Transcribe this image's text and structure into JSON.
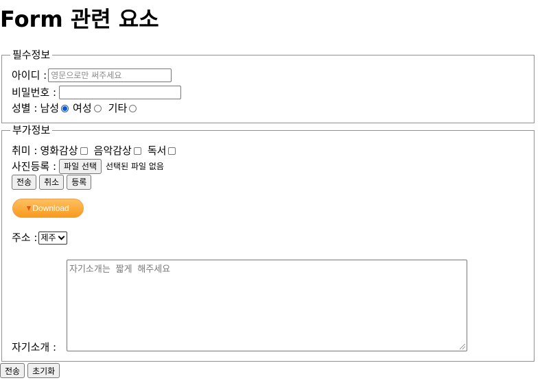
{
  "page": {
    "title": "Form 관련 요소"
  },
  "required": {
    "legend": "필수정보",
    "id_label": "아이디 :",
    "id_placeholder": "영문으로만 써주세요",
    "password_label": "비밀번호 :",
    "password_value": "",
    "gender_label": "성별 :",
    "gender_options": [
      {
        "label": "남성",
        "checked": true
      },
      {
        "label": "여성",
        "checked": false
      },
      {
        "label": "기타",
        "checked": false
      }
    ]
  },
  "additional": {
    "legend": "부가정보",
    "hobby_label": "취미 :",
    "hobby_options": [
      {
        "label": "영화감상",
        "checked": false
      },
      {
        "label": "음악감상",
        "checked": false
      },
      {
        "label": "독서",
        "checked": false
      }
    ],
    "photo_label": "사진등록 :",
    "file_button": "파일 선택",
    "file_status": "선택된 파일 없음",
    "buttons": [
      "전송",
      "취소",
      "등록"
    ],
    "download_label": "Download",
    "address_label": "주소 :",
    "address_selected": "제주",
    "intro_label": "자기소개 :",
    "intro_placeholder": "자기소개는 짧게 해주세요"
  },
  "footer": {
    "submit": "전송",
    "reset": "초기화"
  },
  "colors": {
    "radio_checked": "#0b57d0",
    "download_orange": "#f79a1e",
    "border": "#8f8f8f"
  }
}
